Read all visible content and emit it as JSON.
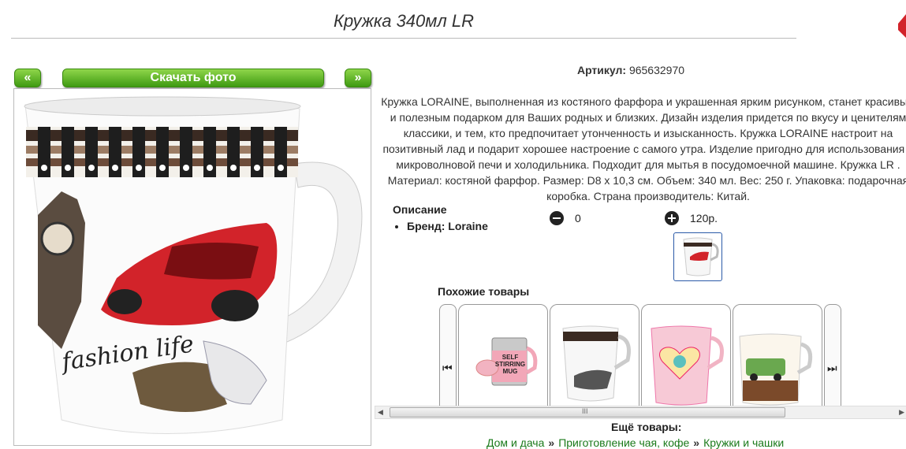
{
  "product": {
    "title": "Кружка 340мл LR",
    "sku_label": "Артикул:",
    "sku_value": "965632970",
    "description": "Кружка LORAINE, выполненная из костяного фарфора и украшенная ярким рисунком, станет красивым и полезным подарком для Ваших родных и близких. Дизайн изделия придется по вкусу и ценителям классики, и тем, кто предпочитает утонченность и изысканность. Кружка LORAINE настроит на позитивный лад и подарит хорошее настроение с самого утра. Изделие пригодно для использования в микроволновой печи и холодильника. Подходит для мытья в посудомоечной машине. Кружка LR . Материал: костяной фарфор. Размер: D8 x 10,3 см. Объем: 340 мл. Вес: 250 г. Упаковка: подарочная коробка. Страна производитель: Китай.",
    "properties_title": "Описание",
    "brand": "Бренд: Loraine",
    "quantity": "0",
    "price": "120р.",
    "mug_print_text": "fashion life"
  },
  "gallery": {
    "prev_label": "«",
    "download_label": "Скачать фото",
    "next_label": "»"
  },
  "similar": {
    "title": "Похожие товары",
    "left_arrow": "⏮",
    "right_arrow": "⏭",
    "items": [
      {
        "kind": "self-stirring",
        "text": "SELF STIRRING MUG"
      },
      {
        "kind": "fashion"
      },
      {
        "kind": "heart"
      },
      {
        "kind": "cafe"
      }
    ]
  },
  "more": {
    "title": "Ещё товары:",
    "breadcrumb": [
      "Дом и дача",
      "Приготовление чая, кофе",
      "Кружки и чашки"
    ],
    "separator": "»"
  },
  "scrollbar": {
    "left_arrow": "◀",
    "right_arrow": "▶",
    "grip": "III"
  },
  "colors": {
    "green_button": "#3f9a12",
    "link_green": "#1a7a1a",
    "car_red": "#d2232a"
  }
}
